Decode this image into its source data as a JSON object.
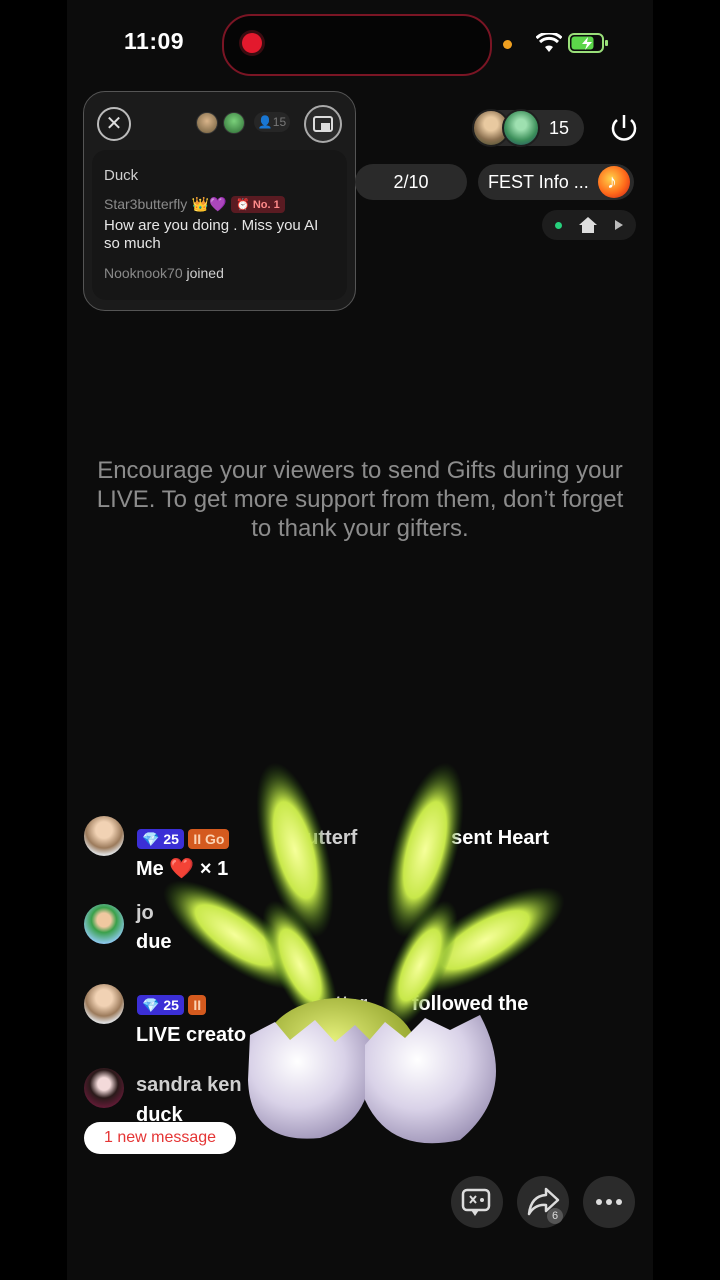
{
  "status_bar": {
    "time": "11:09"
  },
  "popup": {
    "viewer_count": "15",
    "title": "Duck",
    "chat_user": "Star3butterfly",
    "rank_badge": "No. 1",
    "message": "How are you doing . Miss you AI so much",
    "joined_user": "Nooknook70",
    "joined_text": "joined"
  },
  "header": {
    "viewer_count": "15",
    "page_counter": "2/10",
    "fest_label": "FEST Info ..."
  },
  "main": {
    "encourage_text": "Encourage your viewers to send Gifts during your LIVE. To get more support from them, don’t forget to thank your gifters."
  },
  "chat": {
    "messages": [
      {
        "level": "25",
        "tag": "Go",
        "user": "butterf",
        "action": "sent Heart",
        "line2": "Me",
        "count": "× 1"
      },
      {
        "user": "jo",
        "line2": "due"
      },
      {
        "level": "25",
        "user": "butter",
        "action": "followed the",
        "line2": "LIVE creato"
      },
      {
        "user": "sandra ken",
        "line2": "duck"
      }
    ],
    "new_message": "1 new message"
  },
  "bottom": {
    "share_count": "6"
  },
  "colors": {
    "accent_red": "#e3192d",
    "badge_blue": "#3b2fd6",
    "badge_orange": "#d45a1e",
    "new_message_red": "#e53535"
  },
  "icons": [
    "record-icon",
    "wifi-icon",
    "battery-icon",
    "close-icon",
    "pip-icon",
    "power-icon",
    "home-icon",
    "music-icon",
    "gift-toggle-icon",
    "share-icon",
    "more-icon",
    "diamond-icon"
  ]
}
